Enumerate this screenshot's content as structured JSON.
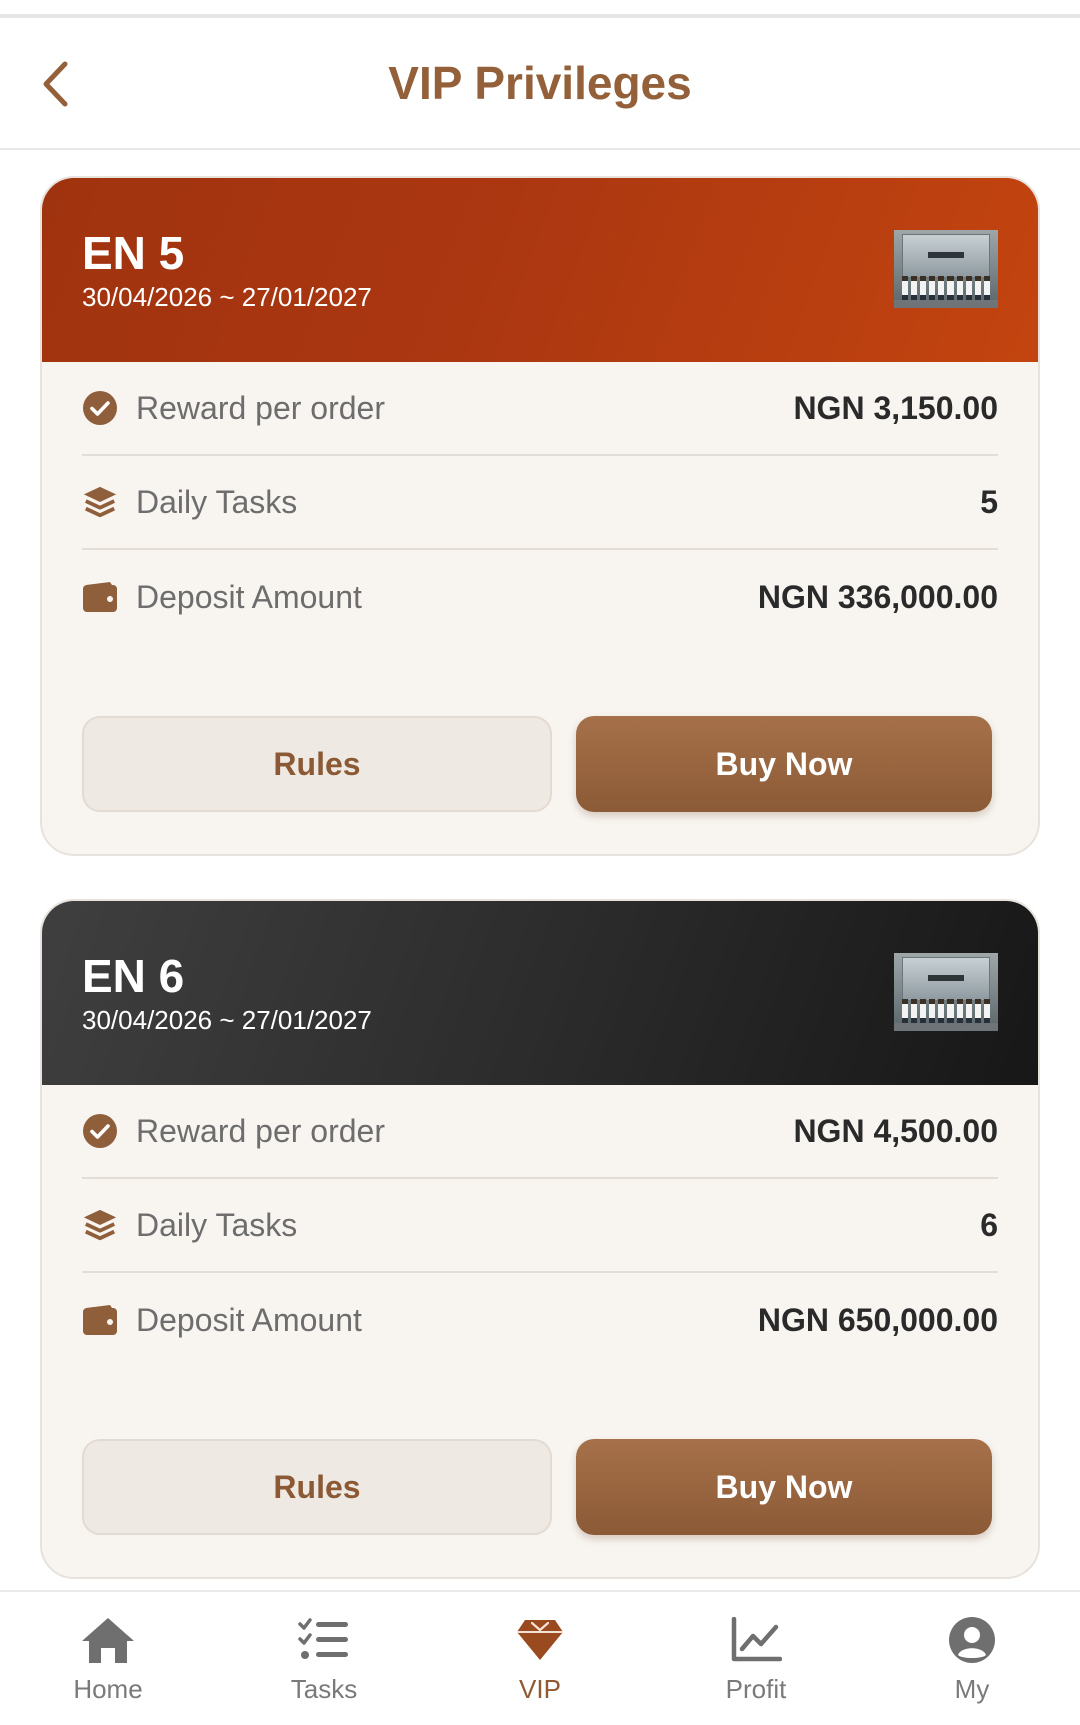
{
  "header": {
    "title": "VIP Privileges"
  },
  "colors": {
    "accent": "#93603a",
    "card_head_orange": "#ab3711",
    "card_head_dark": "#2c2c2c",
    "buy_button": "#9a6640"
  },
  "labels": {
    "reward": "Reward per order",
    "daily": "Daily Tasks",
    "deposit": "Deposit Amount",
    "rules_button": "Rules",
    "buy_button": "Buy Now"
  },
  "cards": [
    {
      "level": "EN 5",
      "period": "30/04/2026 ~ 27/01/2027",
      "reward_per_order": "NGN 3,150.00",
      "daily_tasks": "5",
      "deposit_amount": "NGN 336,000.00"
    },
    {
      "level": "EN 6",
      "period": "30/04/2026 ~ 27/01/2027",
      "reward_per_order": "NGN 4,500.00",
      "daily_tasks": "6",
      "deposit_amount": "NGN 650,000.00"
    }
  ],
  "tabbar": {
    "items": [
      {
        "label": "Home",
        "icon": "home-icon"
      },
      {
        "label": "Tasks",
        "icon": "tasks-list-icon"
      },
      {
        "label": "VIP",
        "icon": "diamond-icon",
        "active": true
      },
      {
        "label": "Profit",
        "icon": "chart-line-icon"
      },
      {
        "label": "My",
        "icon": "user-circle-icon"
      }
    ]
  }
}
